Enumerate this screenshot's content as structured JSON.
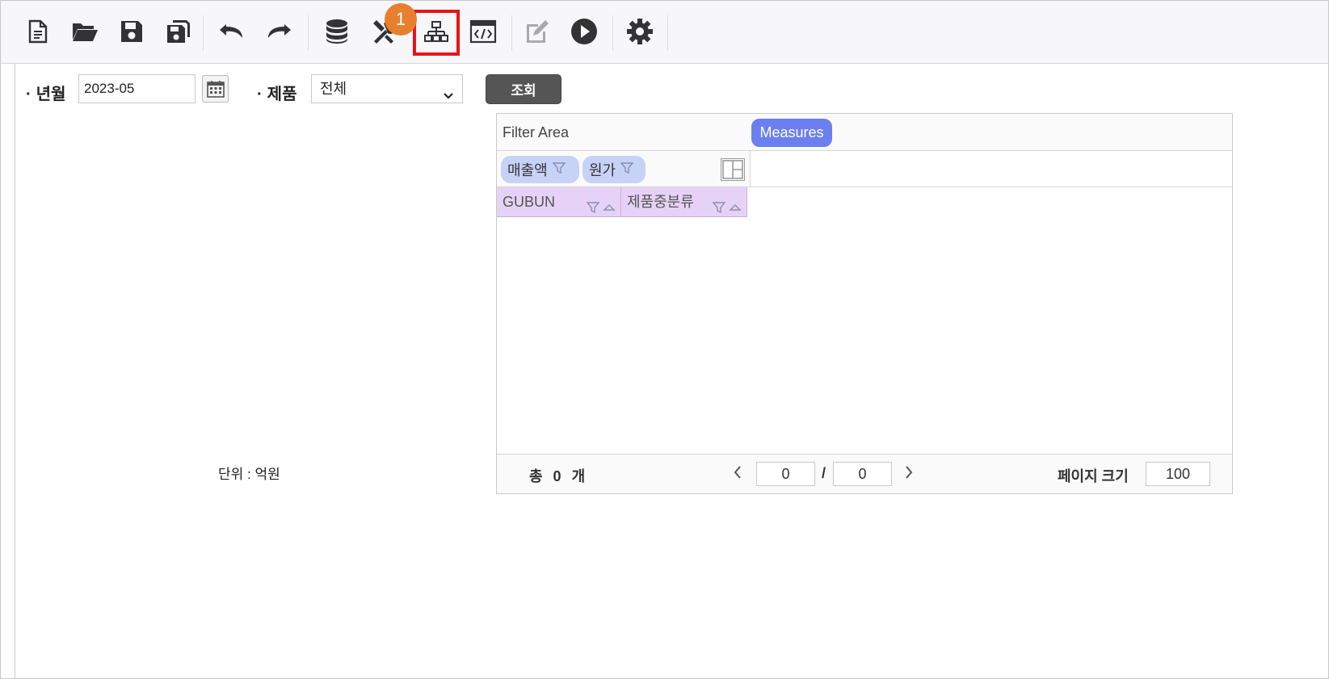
{
  "toolbar": {
    "buttons": [
      {
        "name": "new-document-icon"
      },
      {
        "name": "open-folder-icon"
      },
      {
        "name": "save-icon"
      },
      {
        "name": "save-as-icon"
      },
      {
        "name": "undo-icon"
      },
      {
        "name": "redo-icon"
      },
      {
        "name": "database-icon"
      },
      {
        "name": "tools-icon"
      },
      {
        "name": "hierarchy-icon"
      },
      {
        "name": "code-view-icon"
      },
      {
        "name": "edit-icon"
      },
      {
        "name": "run-icon"
      },
      {
        "name": "settings-icon"
      }
    ],
    "highlight_badge": "1",
    "highlight_color": "#e5141c",
    "badge_color": "#e87f2c"
  },
  "conditions": {
    "year_month_label": "년월",
    "year_month_value": "2023-05",
    "product_label": "제품",
    "product_value": "전체",
    "search_button": "조회"
  },
  "unit_label": "단위 : 억원",
  "pivot": {
    "filter_area_label": "Filter Area",
    "data_fields": [
      "매출액",
      "원가"
    ],
    "measures_label": "Measures",
    "row_fields": [
      "GUBUN",
      "제품중분류"
    ],
    "pager": {
      "total_label": "총 0 개",
      "current_page": "0",
      "slash": "/",
      "total_pages": "0",
      "page_size_label": "페이지 크기",
      "page_size": "100"
    }
  }
}
